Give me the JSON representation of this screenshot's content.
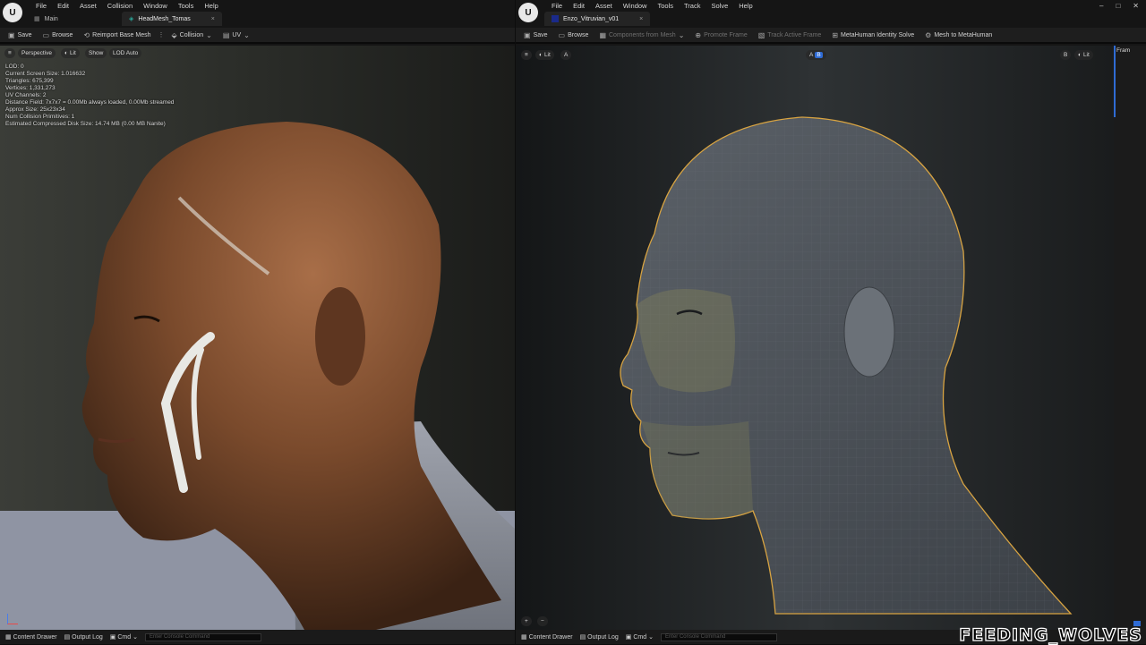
{
  "left": {
    "menu": [
      "File",
      "Edit",
      "Asset",
      "Collision",
      "Window",
      "Tools",
      "Help"
    ],
    "tabs": [
      {
        "label": "Main"
      },
      {
        "label": "HeadMesh_Tomas",
        "close": "×"
      }
    ],
    "toolbar": {
      "save": "Save",
      "browse": "Browse",
      "reimport": "Reimport Base Mesh",
      "collision": "Collision",
      "uv": "UV"
    },
    "viewport": {
      "perspective": "Perspective",
      "lit": "Lit",
      "show": "Show",
      "lod": "LOD Auto"
    },
    "stats": [
      "LOD:  0",
      "Current Screen Size:  1.016632",
      "Triangles:  675,399",
      "Vertices:  1,331,273",
      "UV Channels:  2",
      "Distance Field:  7x7x7 = 0.00Mb always loaded, 0.00Mb streamed",
      "Approx Size: 25x23x34",
      "Num Collision Primitives:  1",
      "Estimated Compressed Disk Size: 14.74 MB (0.00 MB Nanite)"
    ],
    "status": {
      "drawer": "Content Drawer",
      "log": "Output Log",
      "cmd": "Cmd",
      "console_placeholder": "Enter Console Command"
    }
  },
  "right": {
    "menu": [
      "File",
      "Edit",
      "Asset",
      "Window",
      "Tools",
      "Track",
      "Solve",
      "Help"
    ],
    "tabs": [
      {
        "label": "Enzo_Vitruvian_v01",
        "close": "×"
      }
    ],
    "toolbar": {
      "save": "Save",
      "browse": "Browse",
      "components": "Components from Mesh",
      "promote": "Promote Frame",
      "track": "Track Active Frame",
      "identity": "MetaHuman Identity Solve",
      "mesh": "Mesh to MetaHuman"
    },
    "viewport": {
      "lit": "Lit",
      "a": "A",
      "b": "B",
      "ab_a": "A",
      "ab_b": "B",
      "lit2": "Lit",
      "panel": "Fram"
    },
    "status": {
      "drawer": "Content Drawer",
      "log": "Output Log",
      "cmd": "Cmd",
      "console_placeholder": "Enter Console Command"
    }
  },
  "watermark": "FEEDING_WOLVES",
  "window_controls": [
    "–",
    "□",
    "✕"
  ],
  "logo": "U",
  "colors": {
    "accent": "#2f6bd4",
    "outline": "#d9a441",
    "tab_icon": "#2aa89a"
  }
}
